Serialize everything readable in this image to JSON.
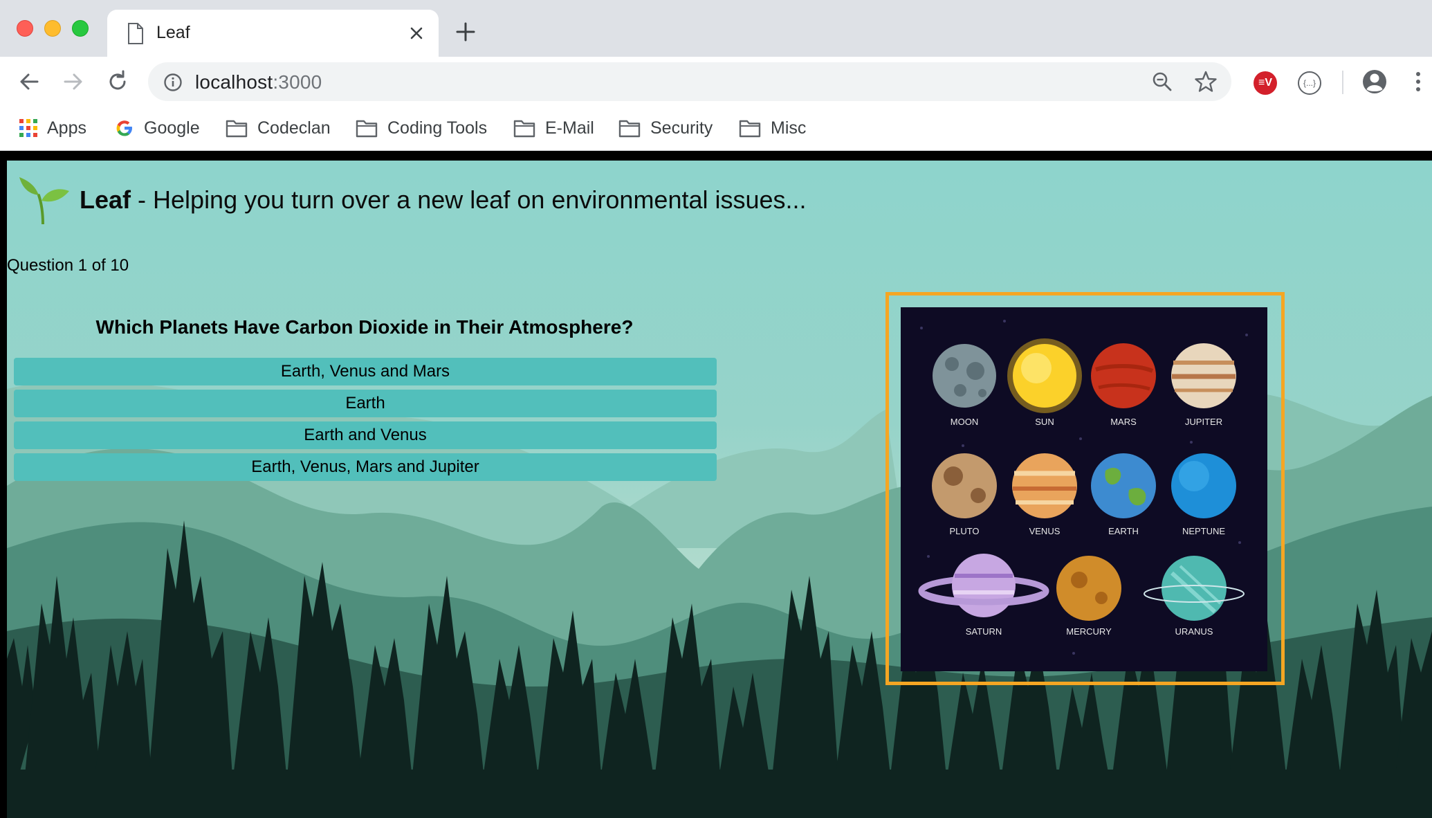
{
  "browser": {
    "tab_title": "Leaf",
    "url_host": "localhost",
    "url_port": ":3000",
    "ext_ev_label": "≡V",
    "ext_json_label": "{...}"
  },
  "bookmarks": [
    {
      "label": "Apps"
    },
    {
      "label": "Google"
    },
    {
      "label": "Codeclan"
    },
    {
      "label": "Coding Tools"
    },
    {
      "label": "E-Mail"
    },
    {
      "label": "Security"
    },
    {
      "label": "Misc"
    }
  ],
  "page": {
    "brand": "Leaf",
    "tagline": " - Helping you turn over a new leaf on environmental issues...",
    "counter": "Question 1 of 10",
    "question": "Which Planets Have Carbon Dioxide in Their Atmosphere?",
    "answers": [
      "Earth, Venus and Mars",
      "Earth",
      "Earth and Venus",
      "Earth, Venus, Mars and Jupiter"
    ],
    "image_labels": [
      "MOON",
      "SUN",
      "MARS",
      "JUPITER",
      "PLUTO",
      "VENUS",
      "EARTH",
      "NEPTUNE",
      "SATURN",
      "MERCURY",
      "URANUS"
    ]
  },
  "colors": {
    "answer_bg": "#52bfbb",
    "frame_border": "#f5a623",
    "image_bg": "#0e0b24"
  }
}
